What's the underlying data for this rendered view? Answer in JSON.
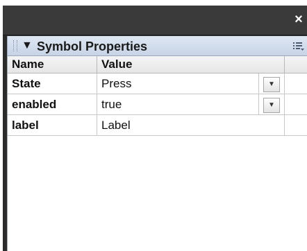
{
  "panel": {
    "title": "Symbol Properties",
    "collapse_glyph": "▼"
  },
  "window": {
    "close_glyph": "×"
  },
  "table": {
    "headers": [
      "Name",
      "Value"
    ],
    "rows": [
      {
        "name": "State",
        "value": "Press",
        "dropdown": true
      },
      {
        "name": "enabled",
        "value": "true",
        "dropdown": true
      },
      {
        "name": "label",
        "value": "Label",
        "dropdown": false
      }
    ]
  },
  "icons": {
    "close": "close-icon",
    "menu": "panel-menu-icon",
    "collapse": "collapse-arrow-icon",
    "dropdown": "chevron-down-icon"
  },
  "colors": {
    "titlebar": "#3a3a3a",
    "panel_header": "#c7d4e6"
  }
}
